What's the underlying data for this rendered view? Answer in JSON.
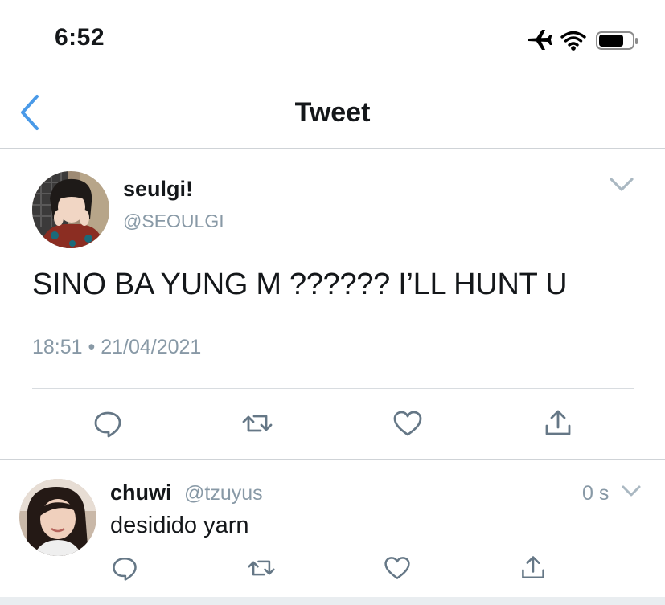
{
  "status_bar": {
    "time": "6:52",
    "icons": [
      "airplane-icon",
      "wifi-icon",
      "battery-icon"
    ]
  },
  "nav": {
    "back_icon": "chevron-left-icon",
    "title": "Tweet"
  },
  "tweet": {
    "display_name": "seulgi!",
    "handle": "@SEOULGI",
    "text": "SINO BA YUNG M ?????? I’LL HUNT U",
    "timestamp": "18:51 • 21/04/2021",
    "actions": [
      "reply-icon",
      "retweet-icon",
      "like-icon",
      "share-icon"
    ]
  },
  "reply": {
    "display_name": "chuwi",
    "handle": "@tzuyus",
    "time": "0 s",
    "text": "desidido yarn",
    "actions": [
      "reply-icon",
      "retweet-icon",
      "like-icon",
      "share-icon"
    ]
  },
  "colors": {
    "accent": "#4a9ae8",
    "secondary_text": "#8899a6",
    "icon_gray": "#657786",
    "divider": "#cfd3d7"
  }
}
